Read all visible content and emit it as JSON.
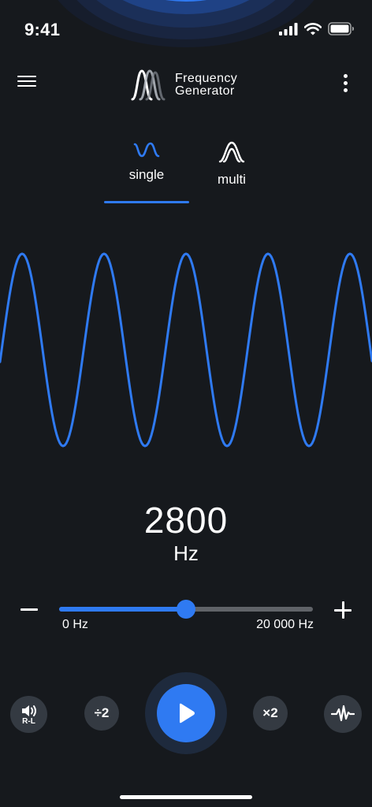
{
  "status": {
    "time": "9:41"
  },
  "app": {
    "title_line1": "Frequency",
    "title_line2": "Generator"
  },
  "tabs": [
    {
      "label": "single",
      "active": true
    },
    {
      "label": "multi",
      "active": false
    }
  ],
  "frequency": {
    "value": "2800",
    "unit": "Hz"
  },
  "slider": {
    "min_label": "0 Hz",
    "max_label": "20 000 Hz",
    "fraction": 0.5
  },
  "controls": {
    "rl_label": "R-L",
    "divide_label": "÷2",
    "multiply_label": "×2"
  },
  "colors": {
    "accent": "#2f7af2",
    "background": "#16191d",
    "button": "#343a42"
  }
}
